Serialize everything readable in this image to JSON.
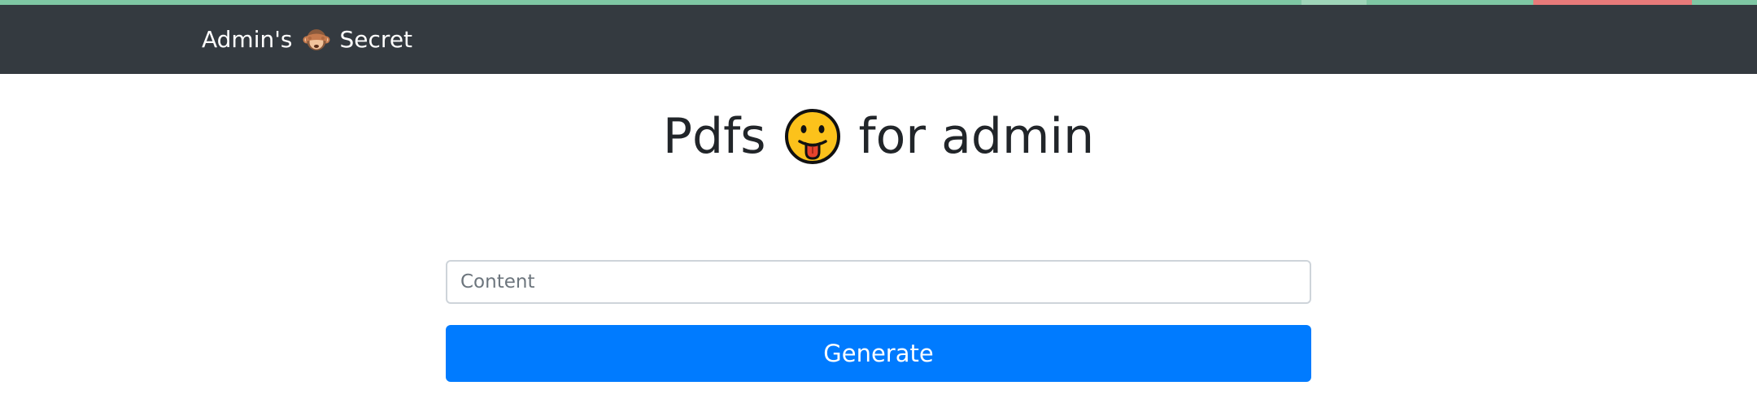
{
  "navbar": {
    "brand_prefix": "Admin's",
    "brand_icon": "see-no-evil-monkey-icon",
    "brand_suffix": "Secret",
    "background_color": "#343a40"
  },
  "main": {
    "title_prefix": "Pdfs",
    "title_icon": "face-with-tongue-icon",
    "title_suffix": "for admin"
  },
  "form": {
    "content_placeholder": "Content",
    "content_value": "",
    "generate_label": "Generate",
    "button_color": "#007bff"
  }
}
